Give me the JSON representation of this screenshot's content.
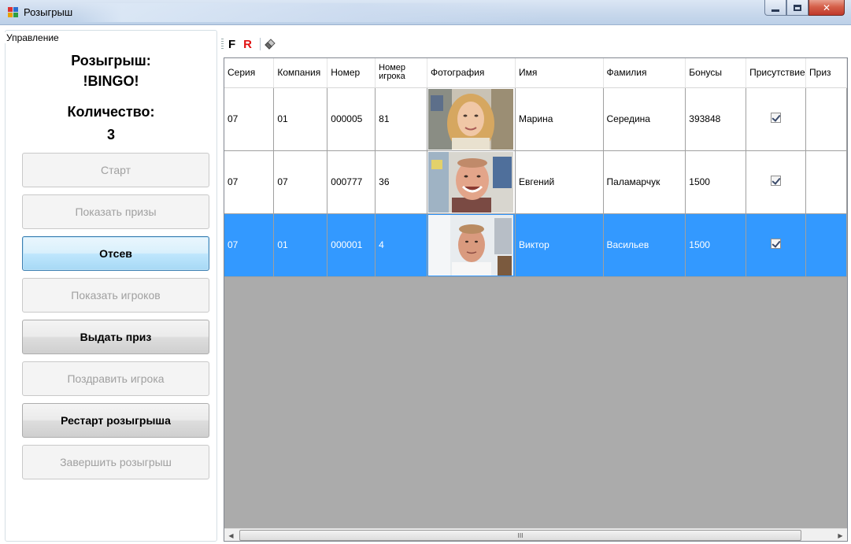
{
  "window": {
    "title": "Розыгрыш"
  },
  "panel": {
    "group_title": "Управление",
    "draw_label": "Розыгрыш:",
    "draw_name": "!BINGO!",
    "count_label": "Количество:",
    "count_value": "3"
  },
  "buttons": [
    {
      "label": "Старт",
      "state": "disabled"
    },
    {
      "label": "Показать призы",
      "state": "disabled"
    },
    {
      "label": "Отсев",
      "state": "focused"
    },
    {
      "label": "Показать игроков",
      "state": "disabled"
    },
    {
      "label": "Выдать приз",
      "state": "enabled"
    },
    {
      "label": "Поздравить игрока",
      "state": "disabled"
    },
    {
      "label": "Рестарт розыгрыша",
      "state": "enabled"
    },
    {
      "label": "Завершить розыгрыш",
      "state": "disabled"
    }
  ],
  "toolbar": {
    "f_label": "F",
    "r_label": "R",
    "eraser_icon": "eraser-icon"
  },
  "grid": {
    "columns": [
      "Серия",
      "Компания",
      "Номер",
      "Номер игрока",
      "Фотография",
      "Имя",
      "Фамилия",
      "Бонусы",
      "Присутствие",
      "Приз"
    ],
    "rows": [
      {
        "series": "07",
        "company": "01",
        "number": "000005",
        "player_number": "81",
        "photo": "woman-portrait",
        "first_name": "Марина",
        "last_name": "Середина",
        "bonus": "393848",
        "present": true,
        "prize": "",
        "selected": false
      },
      {
        "series": "07",
        "company": "07",
        "number": "000777",
        "player_number": "36",
        "photo": "man-portrait-smiling",
        "first_name": "Евгений",
        "last_name": "Паламарчук",
        "bonus": "1500",
        "present": true,
        "prize": "",
        "selected": false
      },
      {
        "series": "07",
        "company": "01",
        "number": "000001",
        "player_number": "4",
        "photo": "man-portrait",
        "first_name": "Виктор",
        "last_name": "Васильев",
        "bonus": "1500",
        "present": true,
        "prize": "",
        "selected": true
      }
    ],
    "scroll_thumb_glyph": "III"
  },
  "colors": {
    "selection": "#3399ff",
    "grid_background": "#ababab",
    "r_button": "#e01010"
  }
}
